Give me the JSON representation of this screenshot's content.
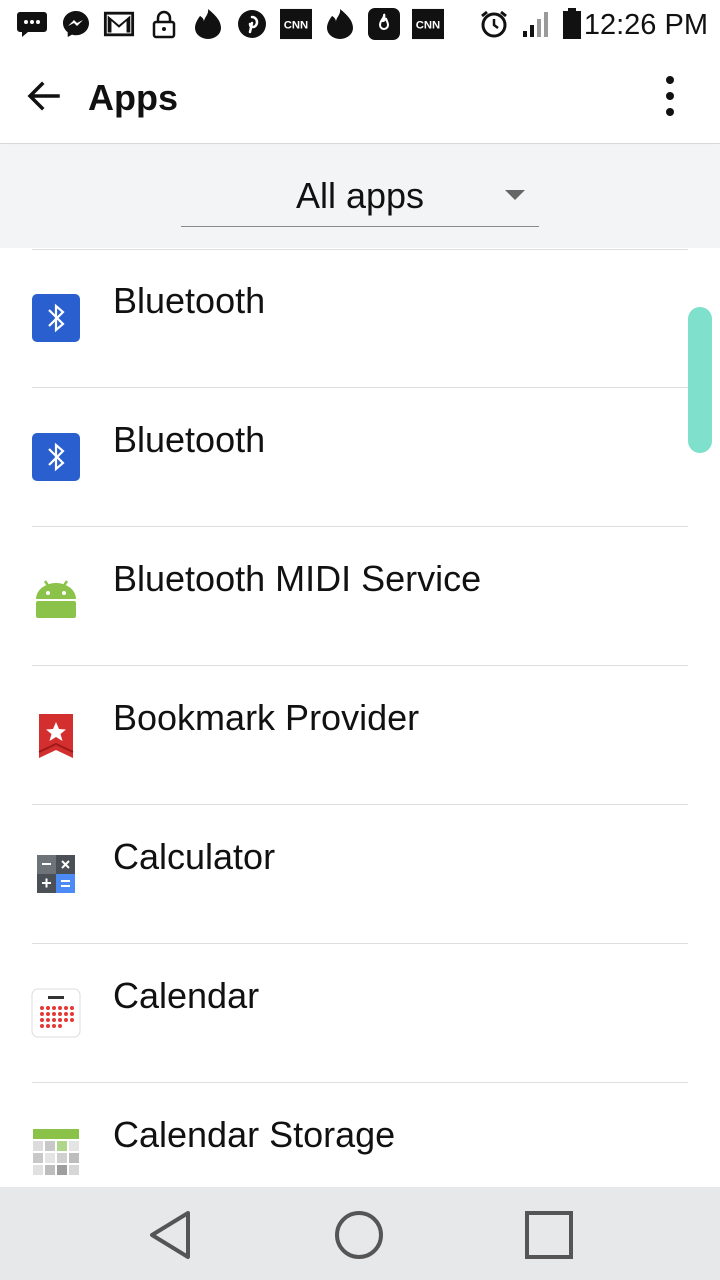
{
  "status_bar": {
    "time": "12:26 PM",
    "notification_icons": [
      "messages-icon",
      "messenger-icon",
      "gmail-icon",
      "lock-icon",
      "tinder-icon",
      "pinterest-icon",
      "cnn-icon",
      "tinder-icon",
      "hot-app-icon",
      "cnn-icon"
    ],
    "system_icons": [
      "alarm-icon",
      "signal-icon",
      "battery-icon"
    ]
  },
  "app_bar": {
    "title": "Apps",
    "back_icon": "arrow-back-icon",
    "menu_icon": "more-vert-icon"
  },
  "filter": {
    "selected": "All apps",
    "dropdown_icon": "triangle-down-icon"
  },
  "apps": [
    {
      "label": "Bluetooth",
      "icon": "bluetooth-icon"
    },
    {
      "label": "Bluetooth",
      "icon": "bluetooth-icon"
    },
    {
      "label": "Bluetooth MIDI Service",
      "icon": "android-icon"
    },
    {
      "label": "Bookmark Provider",
      "icon": "bookmark-icon"
    },
    {
      "label": "Calculator",
      "icon": "calculator-icon"
    },
    {
      "label": "Calendar",
      "icon": "calendar-icon"
    },
    {
      "label": "Calendar Storage",
      "icon": "calendar-storage-icon"
    }
  ],
  "nav_bar": {
    "back": "nav-back-icon",
    "home": "nav-home-icon",
    "recents": "nav-recents-icon"
  },
  "colors": {
    "accent_scroll": "#7fe0cb",
    "bluetooth": "#2a5fd0",
    "android": "#8bc34a",
    "bookmark": "#d32f2f"
  }
}
